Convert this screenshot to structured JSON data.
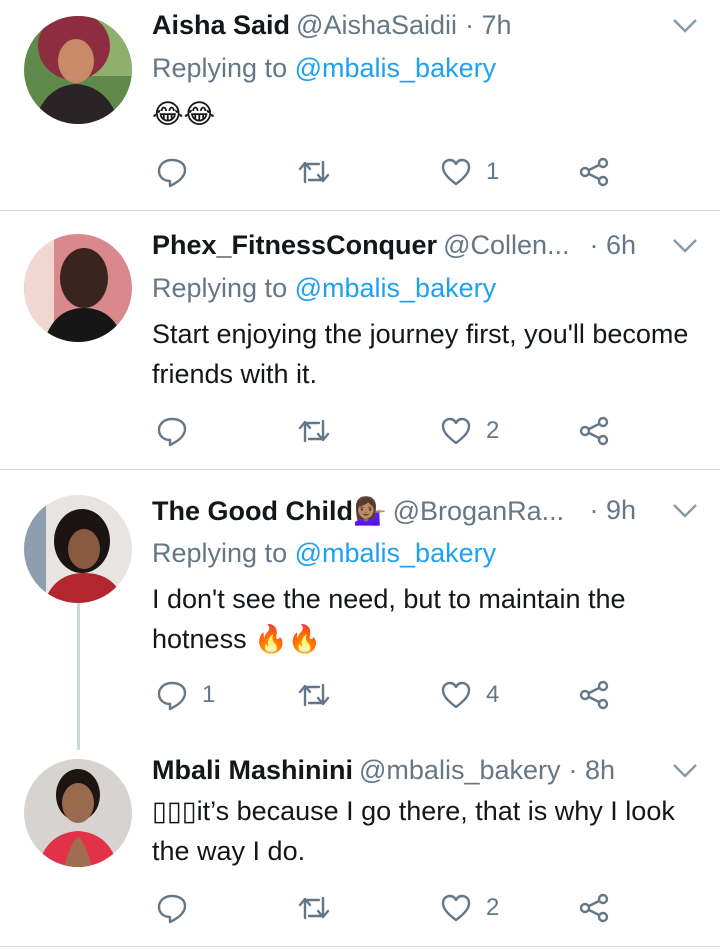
{
  "tweets": [
    {
      "name": "Aisha Said",
      "handle": "@AishaSaidii",
      "time": "· 7h",
      "replying_prefix": "Replying to",
      "replying_to": "@mbalis_bakery",
      "text": "😂😂",
      "reply_count": "",
      "like_count": "1"
    },
    {
      "name": "Phex_FitnessConquer",
      "handle": "@Collen...",
      "time": "· 6h",
      "replying_prefix": "Replying to",
      "replying_to": "@mbalis_bakery",
      "text": "Start enjoying the journey first, you'll become friends with it.",
      "reply_count": "",
      "like_count": "2"
    },
    {
      "name": "The Good Child",
      "name_emoji": "💁🏽‍♀️",
      "handle": "@BroganRa...",
      "time": "· 9h",
      "replying_prefix": "Replying to",
      "replying_to": "@mbalis_bakery",
      "text": "I don't see the need, but to maintain the hotness 🔥🔥",
      "reply_count": "1",
      "like_count": "4"
    },
    {
      "name": "Mbali Mashinini",
      "handle": "@mbalis_bakery",
      "time": "· 8h",
      "text": "▯▯▯it’s because I go there, that is why I look the way I do.",
      "reply_count": "",
      "like_count": "2"
    }
  ],
  "colors": {
    "accent": "#1da1f2",
    "muted": "#657786",
    "divider": "#cfd8dc"
  },
  "icons": [
    "reply-icon",
    "retweet-icon",
    "like-icon",
    "share-icon",
    "chevron-down-icon"
  ]
}
